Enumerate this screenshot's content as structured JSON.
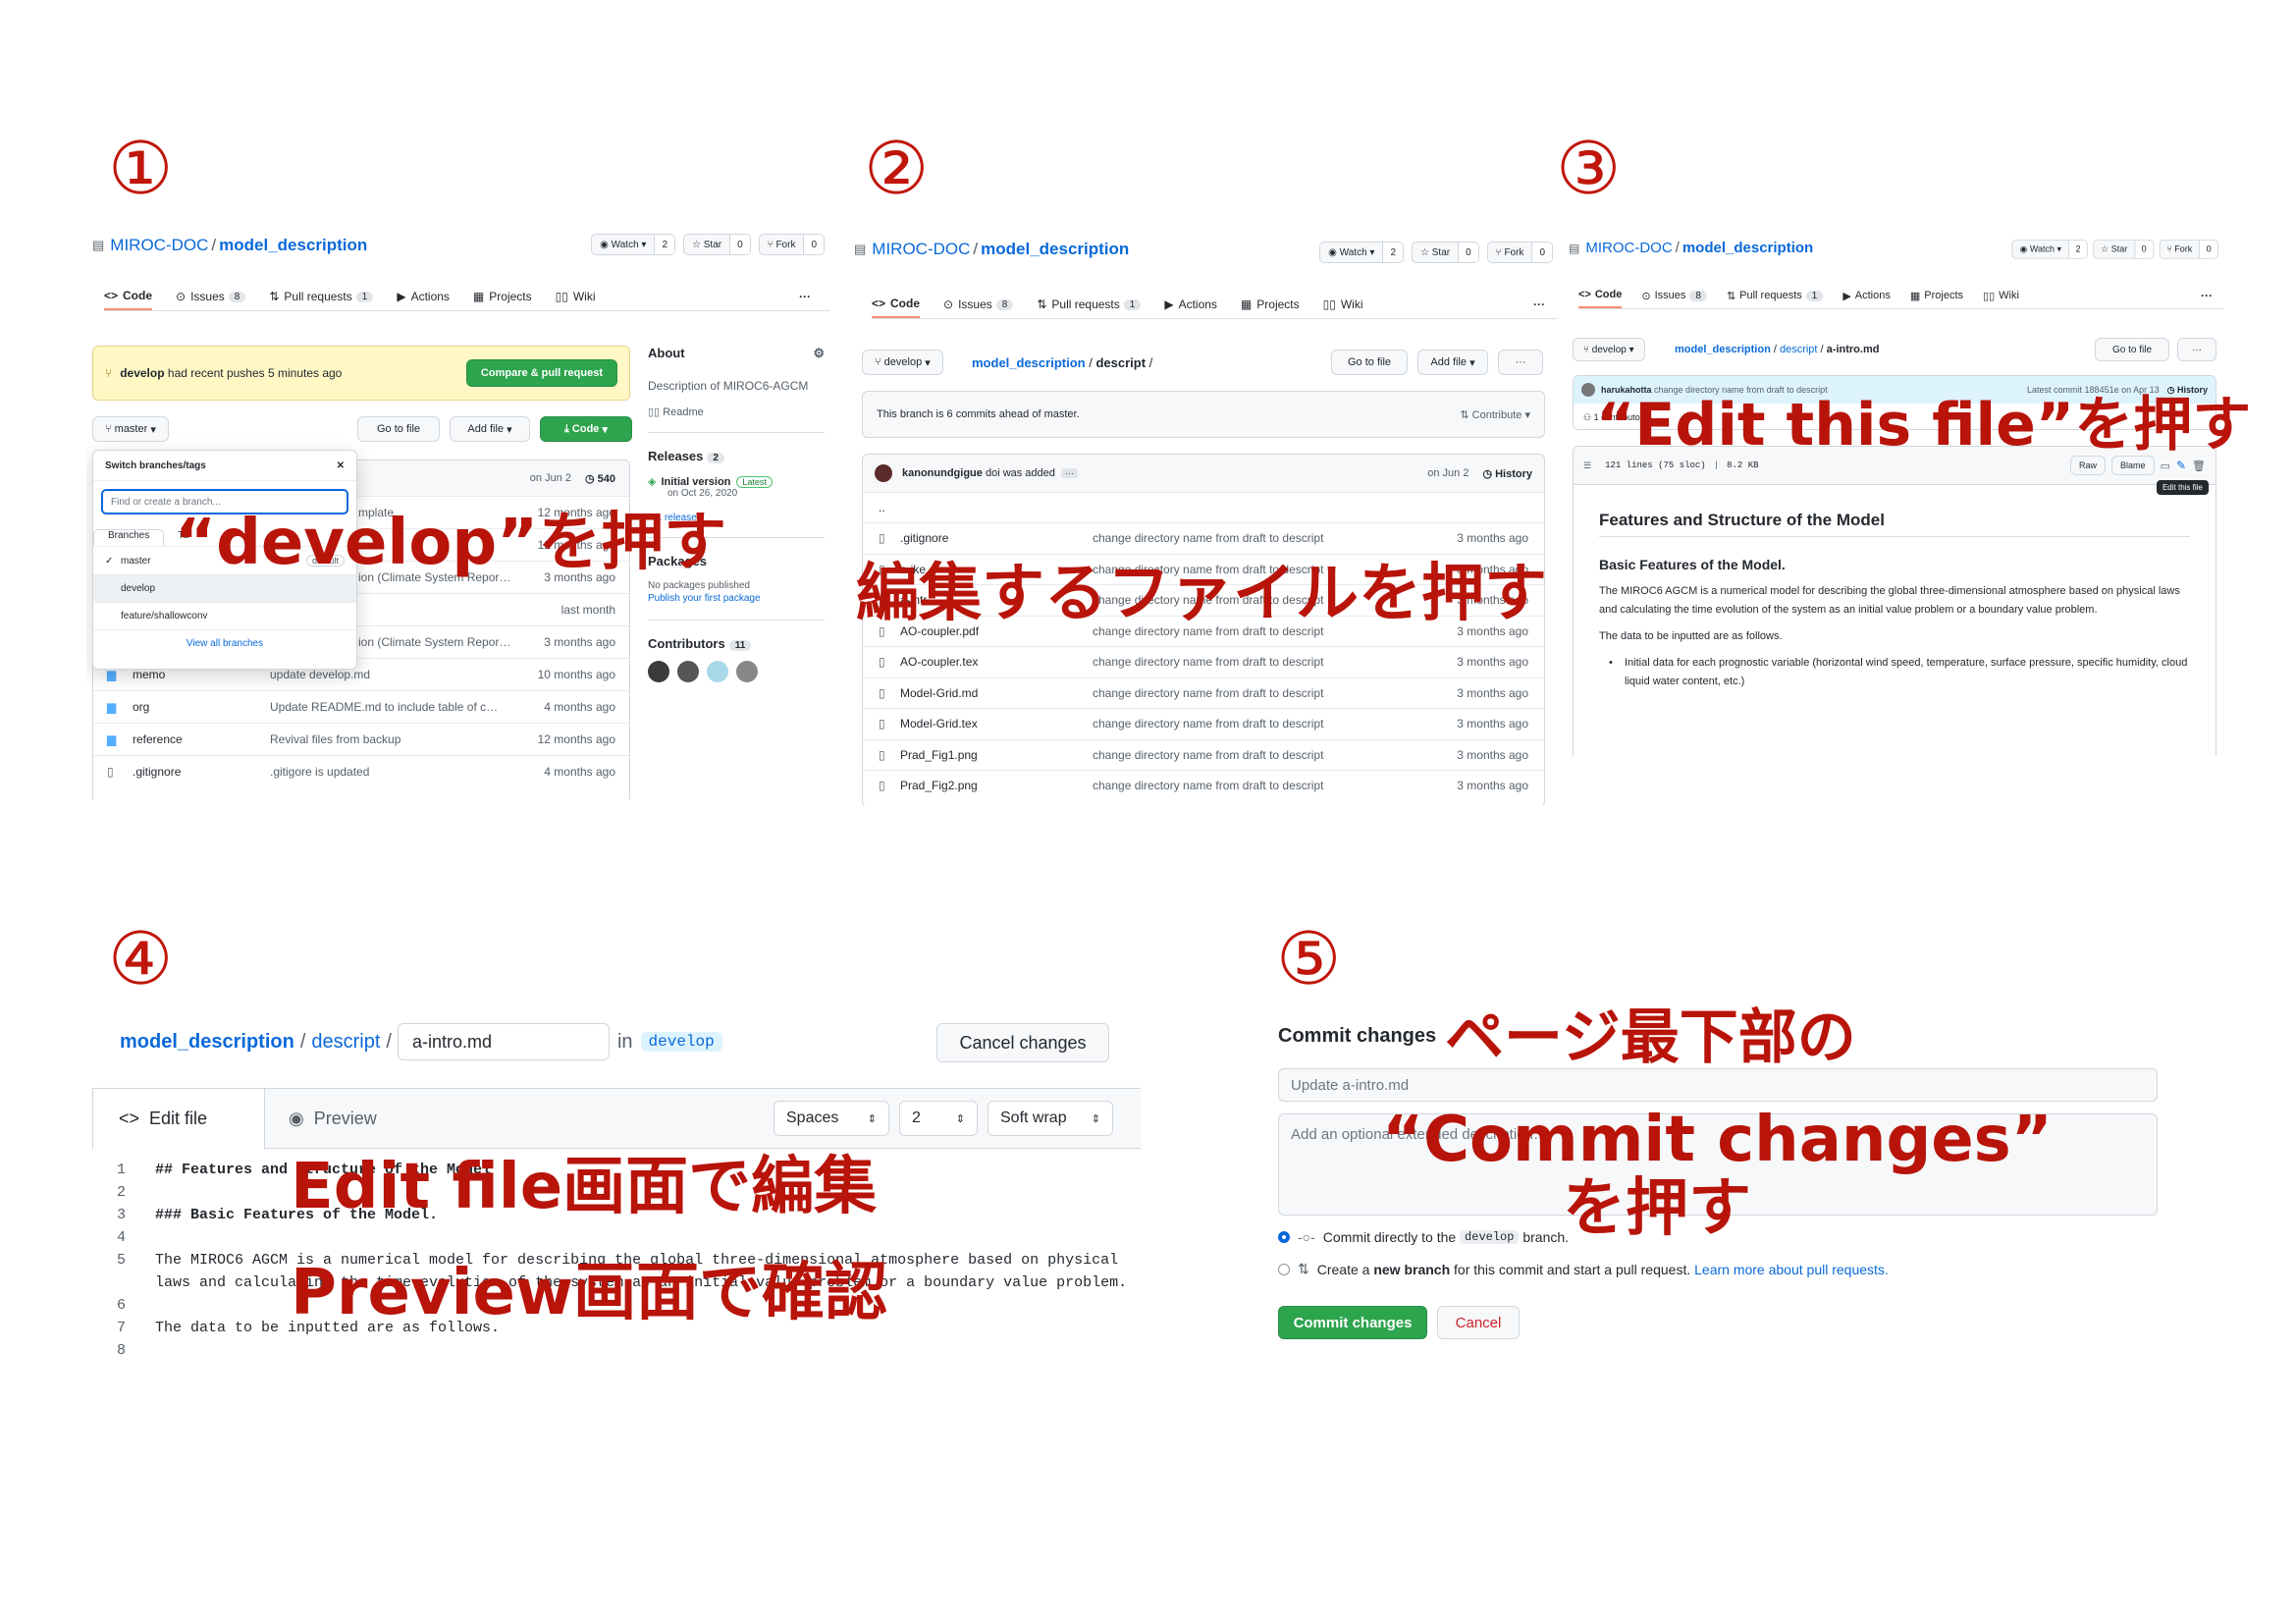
{
  "steps": [
    {
      "number": "①",
      "overlay": "“develop”を押す"
    },
    {
      "number": "②",
      "overlay": "編集するファイルを押す"
    },
    {
      "number": "③",
      "overlay": "“Edit this file”を押す"
    },
    {
      "number": "④",
      "overlay_1": "Edit file画面で編集",
      "overlay_2": "Preview画面で確認"
    },
    {
      "number": "⑤",
      "overlay_1": "ページ最下部の",
      "overlay_2": "“Commit changes”",
      "overlay_3": "を押す"
    }
  ],
  "repo": {
    "owner": "MIROC-DOC",
    "name": "model_description",
    "watch": "Watch",
    "watch_count": "2",
    "star": "Star",
    "star_count": "0",
    "fork": "Fork",
    "fork_count": "0"
  },
  "tabs": {
    "code": "Code",
    "issues": "Issues",
    "issues_count": "8",
    "pulls": "Pull requests",
    "pulls_count": "1",
    "actions": "Actions",
    "projects": "Projects",
    "wiki": "Wiki",
    "more": "···"
  },
  "panel1": {
    "banner_branch": "develop",
    "banner_text": "had recent pushes 5 minutes ago",
    "compare_btn": "Compare & pull request",
    "branch_btn": "master",
    "goto_btn": "Go to file",
    "addfile_btn": "Add file",
    "code_btn": "Code",
    "dropdown": {
      "title": "Switch branches/tags",
      "placeholder": "Find or create a branch...",
      "tab_branches": "Branches",
      "tab_tags": "Ta",
      "items": [
        "master",
        "develop",
        "feature/shallowconv"
      ],
      "default_label": "default",
      "view_all": "View all branches"
    },
    "commit_date": "on Jun 2",
    "commit_count": "540",
    "partial_rows": [
      {
        "msg": "mplate",
        "date": "12 months ago"
      },
      {
        "msg": "…",
        "date": "12 months ago"
      },
      {
        "msg": "ion (Climate System Repor…",
        "date": "3 months ago"
      },
      {
        "msg": "",
        "date": "last month"
      },
      {
        "msg": "ion (Climate System Repor…",
        "date": "3 months ago"
      }
    ],
    "rows": [
      {
        "name": "memo",
        "msg": "update develop.md",
        "date": "10 months ago",
        "type": "dir"
      },
      {
        "name": "org",
        "msg": "Update README.md to include table of c…",
        "date": "4 months ago",
        "type": "dir"
      },
      {
        "name": "reference",
        "msg": "Revival files from backup",
        "date": "12 months ago",
        "type": "dir"
      },
      {
        "name": ".gitignore",
        "msg": ".gitigore is updated",
        "date": "4 months ago",
        "type": "file"
      }
    ],
    "about": {
      "title": "About",
      "desc": "Description of MIROC6-AGCM",
      "readme": "Readme",
      "releases": "Releases",
      "releases_count": "2",
      "release_name": "Initial version",
      "latest": "Latest",
      "release_date": "on Oct 26, 2020",
      "more_release": "+ 1 release",
      "packages": "Packages",
      "packages_none": "No packages published",
      "packages_link": "Publish your first package",
      "contributors": "Contributors",
      "contributors_count": "11"
    }
  },
  "panel2": {
    "branch": "develop",
    "path_repo": "model_description",
    "path_dir": "descript",
    "sep": "/",
    "goto_btn": "Go to file",
    "addfile_btn": "Add file",
    "more": "···",
    "ahead": "This branch is 6 commits ahead of master.",
    "contribute": "Contribute",
    "author": "kanonundgigue",
    "commit_msg": "doi was added",
    "commit_date": "on Jun 2",
    "history": "History",
    "dotdot": "..",
    "rows": [
      {
        "name": ".gitignore",
        "msg": "change directory name from draft to descript",
        "date": "3 months ago"
      },
      {
        "name": "a-ike…",
        "msg": "change directory name from draft to descript",
        "date": "3 months ago"
      },
      {
        "name": "a-intr…",
        "msg": "change directory name from draft to descript",
        "date": "3 months ago"
      },
      {
        "name": "AO-coupler.pdf",
        "msg": "change directory name from draft to descript",
        "date": "3 months ago"
      },
      {
        "name": "AO-coupler.tex",
        "msg": "change directory name from draft to descript",
        "date": "3 months ago"
      },
      {
        "name": "Model-Grid.md",
        "msg": "change directory name from draft to descript",
        "date": "3 months ago"
      },
      {
        "name": "Model-Grid.tex",
        "msg": "change directory name from draft to descript",
        "date": "3 months ago"
      },
      {
        "name": "Prad_Fig1.png",
        "msg": "change directory name from draft to descript",
        "date": "3 months ago"
      },
      {
        "name": "Prad_Fig2.png",
        "msg": "change directory name from draft to descript",
        "date": "3 months ago"
      }
    ]
  },
  "panel3": {
    "branch": "develop",
    "path_repo": "model_description",
    "path_dir": "descript",
    "path_file": "a-intro.md",
    "goto_btn": "Go to file",
    "more": "···",
    "author": "harukahotta",
    "commit_msg": "change directory name from draft to descript",
    "latest_commit": "Latest commit 188451e on Apr 13",
    "history": "History",
    "contributor": "1 contributor",
    "lines": "121 lines (75 sloc)",
    "size": "8.2 KB",
    "raw": "Raw",
    "blame": "Blame",
    "tooltip": "Edit this file",
    "h1": "Features and Structure of the Model",
    "h2": "Basic Features of the Model.",
    "p1": "The MIROC6 AGCM is a numerical model for describing the global three-dimensional atmosphere based on physical laws and calculating the time evolution of the system as an initial value problem or a boundary value problem.",
    "p2": "The data to be inputted are as follows.",
    "li1": "Initial data for each prognostic variable (horizontal wind speed, temperature, surface pressure, specific humidity, cloud liquid water content, etc.)"
  },
  "panel4": {
    "path_repo": "model_description",
    "path_dir": "descript",
    "filename": "a-intro.md",
    "in": "in",
    "branch": "develop",
    "cancel": "Cancel changes",
    "edit_tab": "Edit file",
    "preview_tab": "Preview",
    "spaces": "Spaces",
    "indent": "2",
    "wrap": "Soft wrap",
    "code_lines": [
      {
        "n": "1",
        "t": "## Features and Structure of the Model",
        "b": true
      },
      {
        "n": "2",
        "t": "",
        "b": false
      },
      {
        "n": "3",
        "t": "### Basic Features of the Model.",
        "b": true
      },
      {
        "n": "4",
        "t": "",
        "b": false
      },
      {
        "n": "5",
        "t": "The MIROC6 AGCM is a numerical model for describing the global three-dimensional atmosphere based on physical",
        "b": false
      },
      {
        "n": "",
        "t": "laws and calculating the time evolution of the system as an initial value problem or a boundary value problem.",
        "b": false
      },
      {
        "n": "6",
        "t": "",
        "b": false
      },
      {
        "n": "7",
        "t": "The data to be inputted are as follows.",
        "b": false
      },
      {
        "n": "8",
        "t": "",
        "b": false
      }
    ]
  },
  "panel5": {
    "title": "Commit changes",
    "summary_placeholder": "Update a-intro.md",
    "desc_placeholder": "Add an optional extended description…",
    "opt1_a": "Commit directly to the",
    "opt1_branch": "develop",
    "opt1_b": "branch.",
    "opt2_a": "Create a",
    "opt2_bold": "new branch",
    "opt2_b": "for this commit and start a pull request.",
    "opt2_link": "Learn more about pull requests.",
    "commit_btn": "Commit changes",
    "cancel_btn": "Cancel"
  }
}
